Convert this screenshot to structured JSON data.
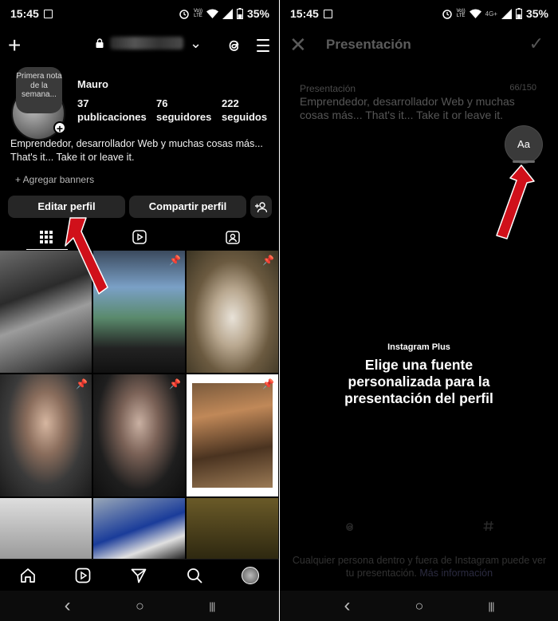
{
  "status": {
    "time": "15:45",
    "net_label_top": "Vo))",
    "net_label_bottom": "LTE",
    "signal_label": "4G+",
    "battery": "35%"
  },
  "profile": {
    "header": {
      "create_glyph": "+",
      "username_chevron": "⌄"
    },
    "note_text": "Primera nota de la semana...",
    "avatar_badge": "+",
    "name": "Mauro",
    "stats": {
      "posts_count": "37",
      "posts_label": "publicaciones",
      "followers_count": "76",
      "followers_label": "seguidores",
      "following_count": "222",
      "following_label": "seguidos"
    },
    "bio": "Emprendedor, desarrollador Web y muchas cosas más... That's it... Take it or leave it.",
    "add_banners": "+  Agregar banners",
    "edit_button": "Editar perfil",
    "share_button": "Compartir perfil"
  },
  "grid": {
    "pin_glyph": "📌"
  },
  "edit_bio": {
    "close_glyph": "✕",
    "title": "Presentación",
    "confirm_glyph": "✓",
    "field_label": "Presentación",
    "counter": "66/150",
    "field_text": "Emprendedor, desarrollador Web y muchas cosas más... That's it... Take it or leave it.",
    "font_button": "Aa",
    "promo_label": "Instagram Plus",
    "promo_headline": "Elige una fuente personalizada para la presentación del perfil",
    "footer_text": "Cualquier persona dentro y fuera de Instagram puede ver tu presentación.",
    "footer_link": "Más información"
  },
  "system_nav": {
    "back": "‹",
    "home": "○",
    "recents": "|||"
  },
  "colors": {
    "background": "#000000",
    "button": "#262626",
    "annotation_arrow": "#d0101a"
  },
  "icons": [
    "wifi-icon",
    "signal-icon",
    "battery-icon",
    "alarm-icon",
    "lock-icon",
    "threads-icon",
    "menu-icon",
    "grid-icon",
    "reels-icon",
    "tagged-icon",
    "home-icon",
    "send-icon",
    "search-icon",
    "add-person-icon"
  ]
}
